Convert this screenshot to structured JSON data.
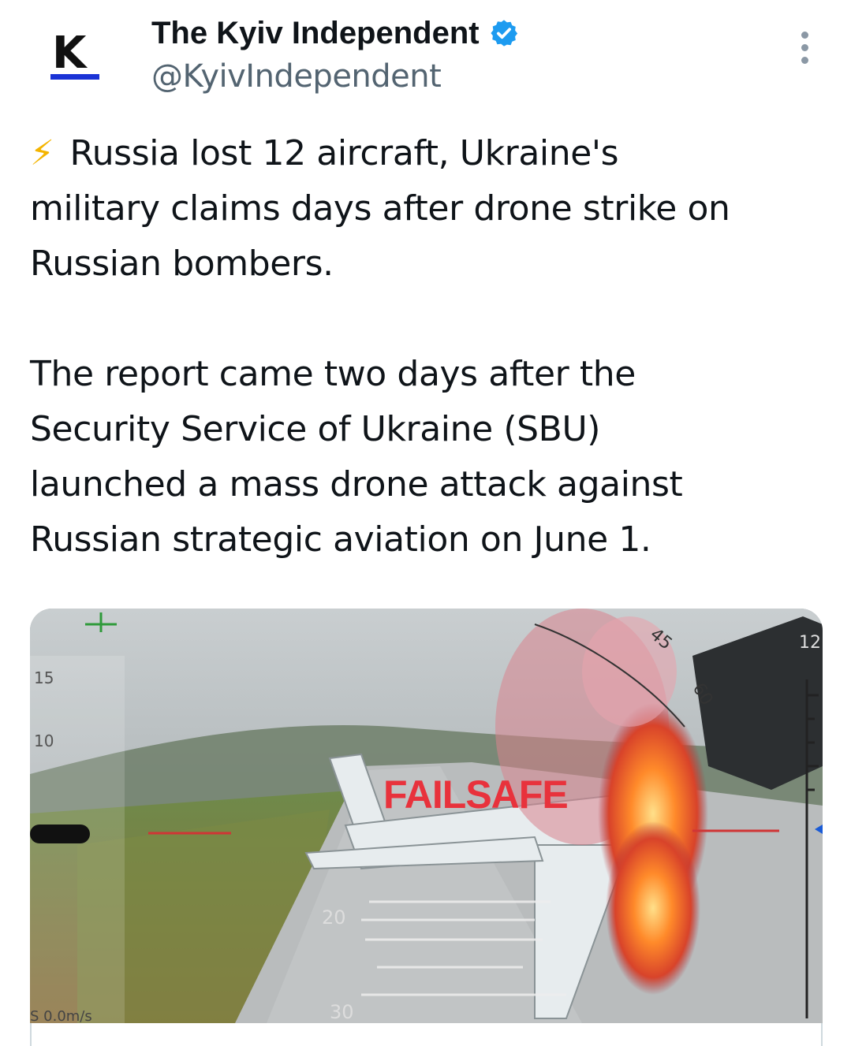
{
  "account": {
    "display_name": "The Kyiv Independent",
    "handle": "@KyivIndependent",
    "avatar_letter": "K",
    "verified": true
  },
  "tweet": {
    "lines": [
      "Russia lost 12 aircraft, Ukraine's",
      "military claims days after drone strike on",
      "Russian bombers.",
      "",
      "The report came two days after the",
      "Security Service of Ukraine (SBU)",
      "launched a mass drone attack against",
      "Russian strategic aviation on June 1."
    ],
    "emoji": "⚡"
  },
  "media": {
    "overlay_text": "FAILSAFE",
    "hud": {
      "left_scale": [
        "15",
        "10"
      ],
      "heading": [
        "45",
        "60"
      ],
      "right_value": "12",
      "pitch_marks": [
        "20",
        "30"
      ],
      "speed": "S 0.0m/s"
    }
  },
  "colors": {
    "verified": "#1d9bf0",
    "bolt": "#f4b400",
    "failsafe": "#e8323c",
    "handle": "#536471"
  }
}
